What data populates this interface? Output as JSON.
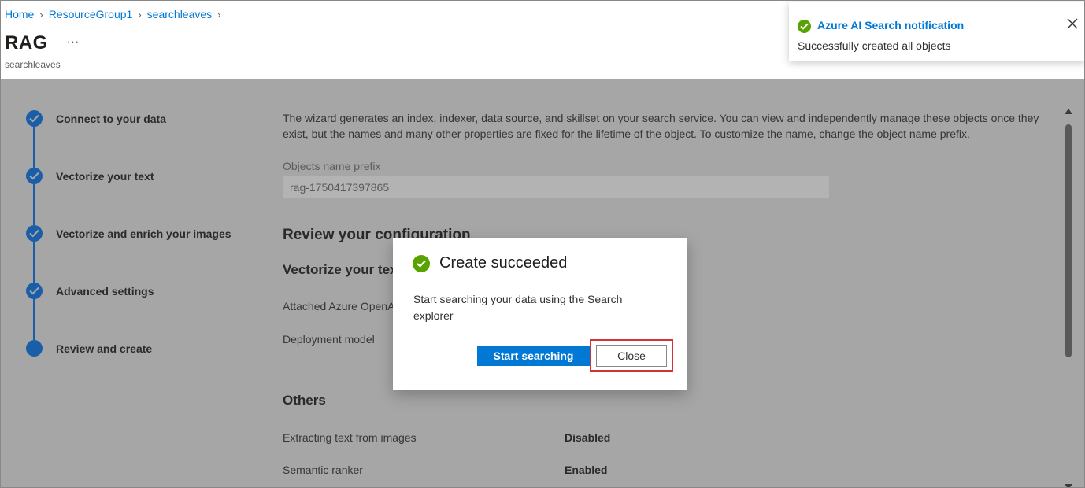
{
  "breadcrumb": {
    "items": [
      "Home",
      "ResourceGroup1",
      "searchleaves"
    ],
    "separator": ">"
  },
  "header": {
    "title": "RAG",
    "more": "···",
    "subtitle": "searchleaves"
  },
  "steps": [
    {
      "label": "Connect to your data",
      "state": "done"
    },
    {
      "label": "Vectorize your text",
      "state": "done"
    },
    {
      "label": "Vectorize and enrich your images",
      "state": "done"
    },
    {
      "label": "Advanced settings",
      "state": "done"
    },
    {
      "label": "Review and create",
      "state": "current"
    }
  ],
  "content": {
    "intro": "The wizard generates an index, indexer, data source, and skillset on your search service. You can view and independently manage these objects once they exist, but the names and many other properties are fixed for the lifetime of the object. To customize the name, change the object name prefix.",
    "prefix_label": "Objects name prefix",
    "prefix_value": "rag-1750417397865",
    "review_heading": "Review your configuration",
    "vectorize_heading": "Vectorize your text",
    "attached_label": "Attached Azure OpenAI",
    "deployment_label": "Deployment model",
    "others_heading": "Others",
    "extract_label": "Extracting text from images",
    "extract_value": "Disabled",
    "semantic_label": "Semantic ranker",
    "semantic_value": "Enabled"
  },
  "dialog": {
    "title": "Create succeeded",
    "body": "Start searching your data using the Search explorer",
    "primary_button": "Start searching",
    "close_button": "Close"
  },
  "notification": {
    "title": "Azure AI Search notification",
    "message": "Successfully created all objects"
  },
  "colors": {
    "accent": "#0078d4",
    "success": "#57a300",
    "step": "#1a5ea8",
    "highlight": "#d13438"
  }
}
